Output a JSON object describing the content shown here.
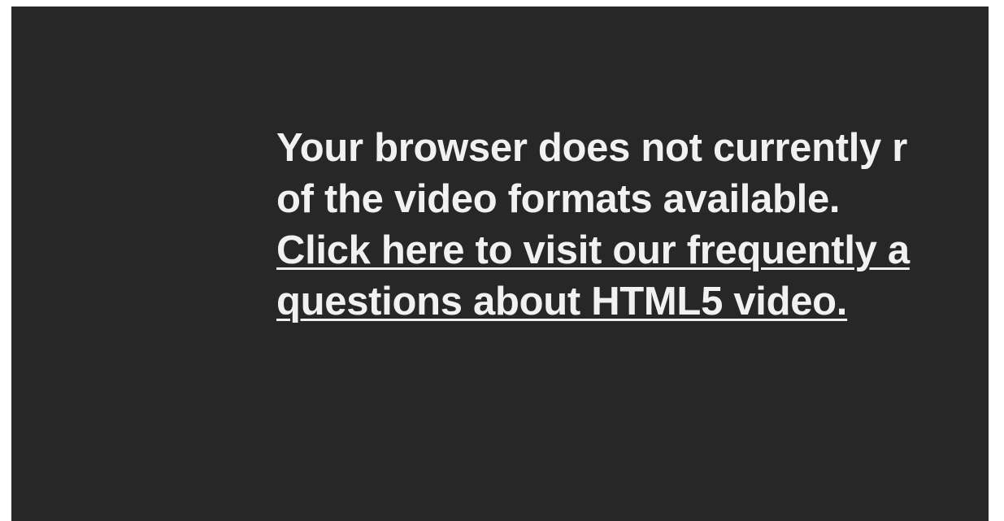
{
  "player": {
    "error": {
      "message_line_1": "Your browser does not currently r",
      "message_line_2": "of the video formats available.",
      "link_line_1": "Click here to visit our frequently a",
      "link_line_2": "questions about HTML5 video."
    }
  },
  "colors": {
    "player_background": "#272727",
    "text": "#f1f1f1",
    "page_background": "#ffffff"
  }
}
